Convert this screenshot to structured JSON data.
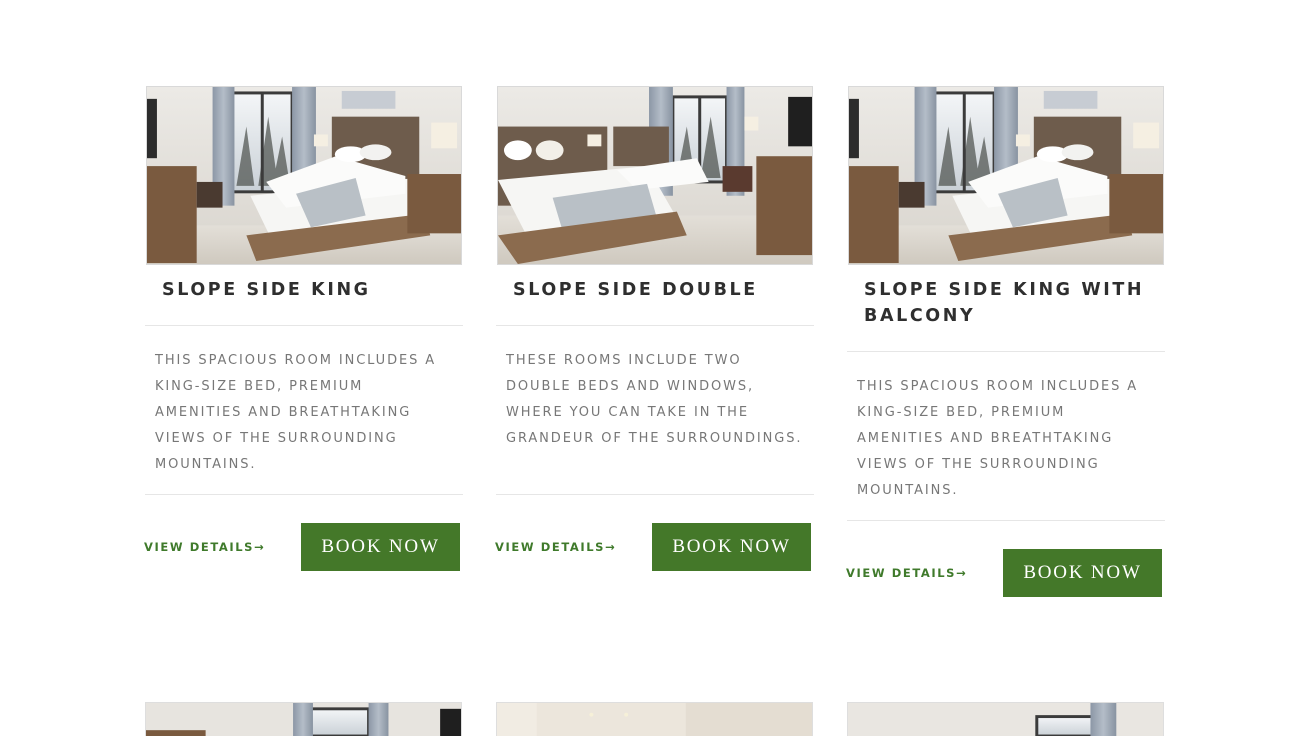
{
  "rooms": [
    {
      "title": "SLOPE SIDE KING",
      "description": "THIS SPACIOUS ROOM INCLUDES A KING-SIZE BED, PREMIUM AMENITIES AND BREATHTAKING VIEWS OF THE SURROUNDING MOUNTAINS.",
      "view_details": "VIEW DETAILS→",
      "book_now": "BOOK NOW",
      "image": "hotel-room-king-photo"
    },
    {
      "title": "SLOPE SIDE DOUBLE",
      "description": "THESE ROOMS INCLUDE TWO DOUBLE BEDS AND WINDOWS, WHERE YOU CAN TAKE IN THE GRANDEUR OF THE SURROUNDINGS.",
      "view_details": "VIEW DETAILS→",
      "book_now": "BOOK NOW",
      "image": "hotel-room-double-photo"
    },
    {
      "title": "SLOPE SIDE KING WITH BALCONY",
      "description": "THIS SPACIOUS ROOM INCLUDES A KING-SIZE BED, PREMIUM AMENITIES AND BREATHTAKING VIEWS OF THE SURROUNDING MOUNTAINS.",
      "view_details": "VIEW DETAILS→",
      "book_now": "BOOK NOW",
      "image": "hotel-room-king-balcony-photo"
    }
  ],
  "colors": {
    "accent_green": "#447829",
    "link_green": "#3f7a2b",
    "title_text": "#2f2f2f",
    "body_text": "#777777"
  }
}
